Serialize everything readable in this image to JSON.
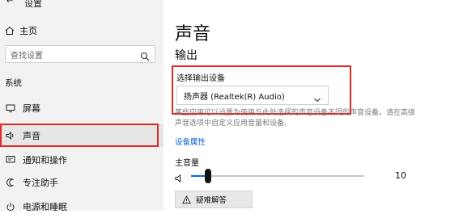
{
  "sidebar": {
    "header_text": "设置",
    "home_label": "主页",
    "search_placeholder": "查找设置",
    "section_label": "系统",
    "items": [
      {
        "label": "屏幕",
        "icon": "monitor-icon"
      },
      {
        "label": "声音",
        "icon": "speaker-icon",
        "active": true
      },
      {
        "label": "通知和操作",
        "icon": "notification-icon"
      },
      {
        "label": "专注助手",
        "icon": "moon-icon"
      },
      {
        "label": "电源和睡眠",
        "icon": "power-icon"
      }
    ]
  },
  "main": {
    "title": "声音",
    "output_heading": "输出",
    "output_device_label": "选择输出设备",
    "output_device_value": "扬声器 (Realtek(R) Audio)",
    "description": "某些应用可以设置为使用与此处选择的声音设备不同的声音设备。请在高级声音选项中自定义应用音量和设备。",
    "device_properties_link": "设备属性",
    "master_volume_label": "主音量",
    "volume_value": "10",
    "volume_fraction": 0.1,
    "troubleshoot_label": "疑难解答"
  },
  "colors": {
    "accent": "#0a64d8",
    "highlight_box": "#e32626",
    "sidebar_bg": "#f2f2f2"
  }
}
